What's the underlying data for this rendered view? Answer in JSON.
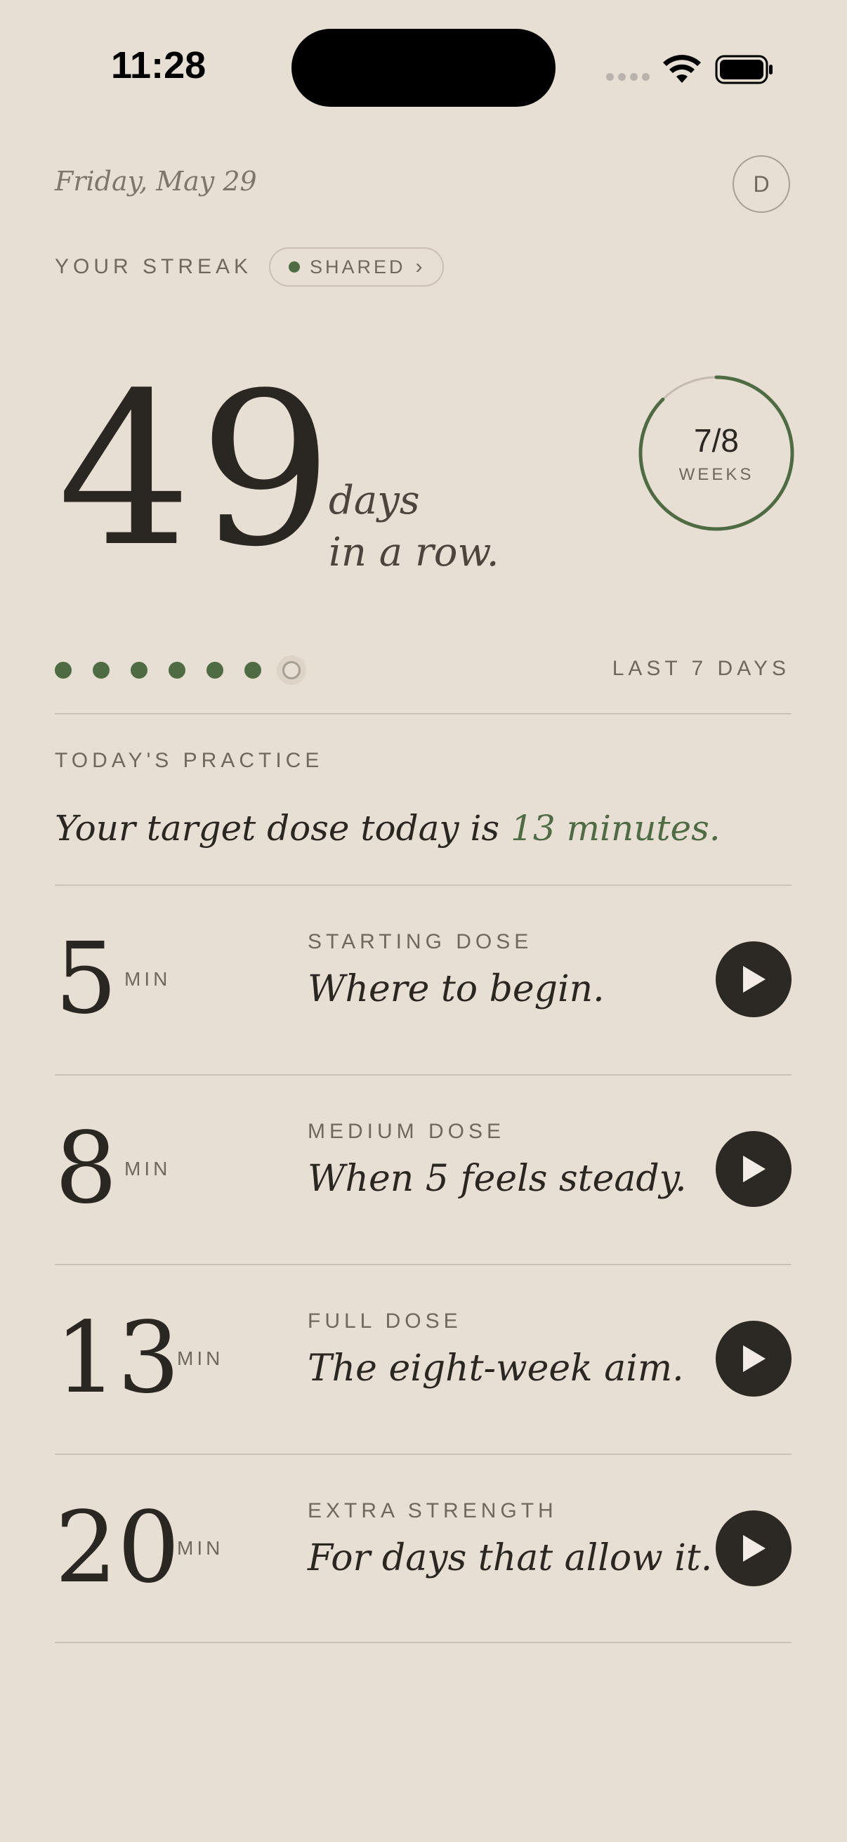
{
  "status_bar": {
    "time": "11:28"
  },
  "header": {
    "date": "Friday, May 29",
    "avatar_initial": "D"
  },
  "streak": {
    "label": "YOUR STREAK",
    "shared_label": "SHARED",
    "shared_chevron": "›",
    "count": "49",
    "days_line1": "days",
    "days_line2": "in a row."
  },
  "weeks": {
    "value": "7/8",
    "label": "WEEKS",
    "progress": 0.875
  },
  "week_dots": {
    "completed": 6,
    "total": 7,
    "label": "LAST 7 DAYS"
  },
  "practice": {
    "label": "TODAY'S PRACTICE",
    "sentence_prefix": "Your target dose today is ",
    "sentence_accent": "13 minutes."
  },
  "doses": [
    {
      "minutes": "5",
      "unit": "MIN",
      "kicker": "STARTING DOSE",
      "description": "Where to begin."
    },
    {
      "minutes": "8",
      "unit": "MIN",
      "kicker": "MEDIUM DOSE",
      "description": "When 5 feels steady."
    },
    {
      "minutes": "13",
      "unit": "MIN",
      "kicker": "FULL DOSE",
      "description": "The eight-week aim."
    },
    {
      "minutes": "20",
      "unit": "MIN",
      "kicker": "EXTRA STRENGTH",
      "description": "For days that allow it."
    }
  ],
  "colors": {
    "background": "#e8dfd4",
    "accent": "#4f6b43",
    "ink": "#2a2622",
    "muted": "#6f685f"
  }
}
